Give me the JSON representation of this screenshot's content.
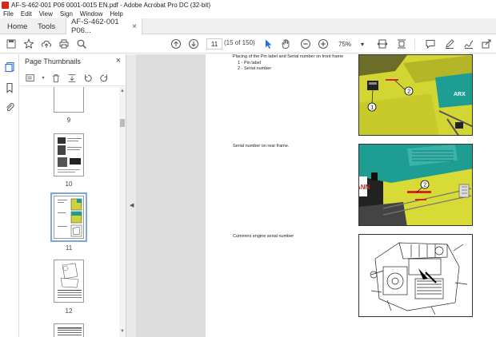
{
  "window": {
    "title": "AF-S-462-001 P06 0001-0015 EN.pdf - Adobe Acrobat Pro DC (32-bit)"
  },
  "menu": [
    "File",
    "Edit",
    "View",
    "Sign",
    "Window",
    "Help"
  ],
  "tabs": {
    "home": "Home",
    "tools": "Tools",
    "doc": "AF-S-462-001 P06...",
    "close": "×"
  },
  "toolbar": {
    "page_current": "11",
    "page_count": "(15 of 150)",
    "zoom": "75%"
  },
  "panel": {
    "title": "Page Thumbnails",
    "close": "×",
    "thumbs": [
      "9",
      "10",
      "11",
      "12"
    ]
  },
  "page": {
    "caption1": "Placing of the Pin label and Serial number on front frame",
    "item1": "1 - Pin label",
    "item2": "2 - Serial number",
    "caption2": "Serial number on rear frame.",
    "caption3": "Cummins engine serial number",
    "fig1_brand": "ARX",
    "fig1_callout1": "1",
    "fig1_callout2": "2",
    "fig2_brand": "ANN",
    "fig2_callout": "2"
  },
  "colors": {
    "machine_yellow": "#d6d834",
    "machine_teal": "#1e9d93",
    "acrobat_red": "#d9261c",
    "selection_blue": "#7aa7d8"
  }
}
